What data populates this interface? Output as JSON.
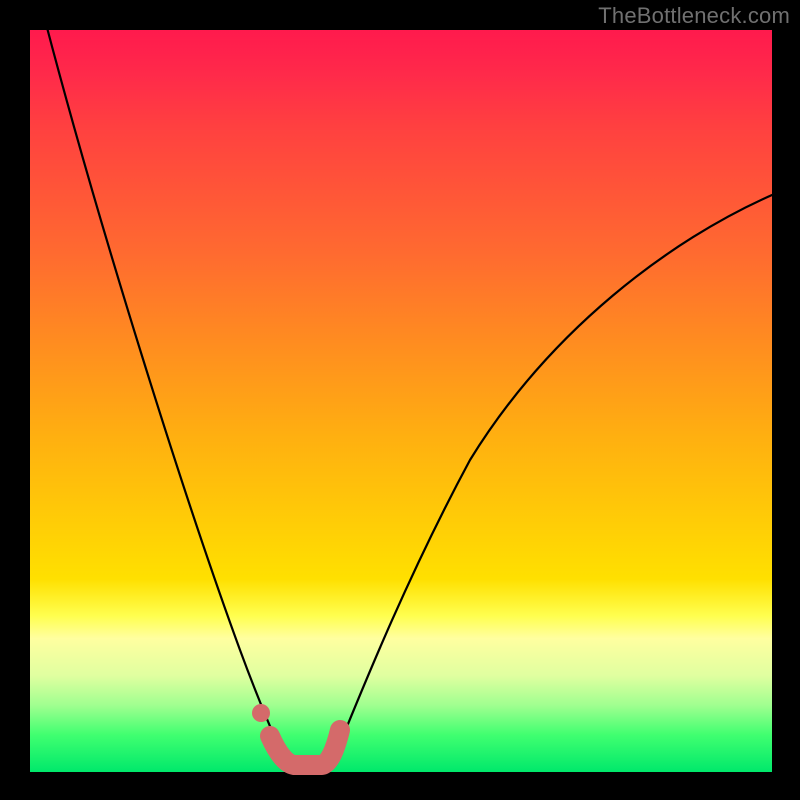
{
  "watermark": "TheBottleneck.com",
  "chart_data": {
    "type": "line",
    "title": "",
    "xlabel": "",
    "ylabel": "",
    "xlim": [
      0,
      100
    ],
    "ylim": [
      0,
      100
    ],
    "series": [
      {
        "name": "left-curve",
        "x": [
          2,
          5,
          8,
          12,
          16,
          20,
          24,
          27,
          29,
          31,
          33,
          34.5
        ],
        "y": [
          100,
          82,
          67,
          51,
          38,
          27,
          17,
          10,
          6,
          3,
          1.2,
          0.3
        ]
      },
      {
        "name": "right-curve",
        "x": [
          40,
          42,
          45,
          49,
          54,
          60,
          67,
          75,
          83,
          91,
          99
        ],
        "y": [
          0.3,
          3,
          9,
          18,
          30,
          42,
          53,
          62,
          69,
          74,
          78
        ]
      },
      {
        "name": "trough-highlight",
        "x": [
          32.5,
          34,
          35.5,
          37,
          38.5,
          40
        ],
        "y": [
          3.5,
          0.8,
          0.2,
          0.2,
          0.8,
          4.2
        ]
      }
    ],
    "annotations": [
      {
        "name": "left-marker-dot",
        "x": 31.2,
        "y": 7.0
      }
    ],
    "background_gradient": {
      "top": "#ff1a4d",
      "mid": "#ffe000",
      "bottom": "#00e86b"
    },
    "highlight_color": "#d46a6a"
  }
}
